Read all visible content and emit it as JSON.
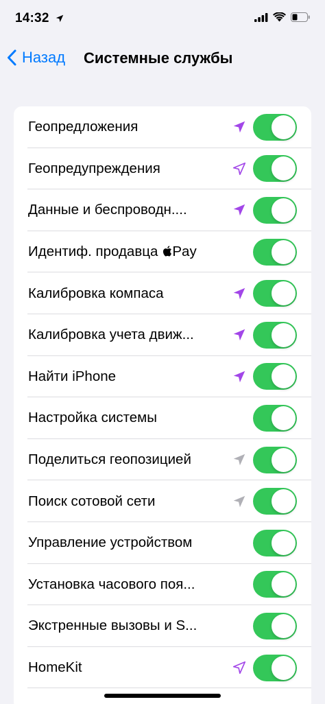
{
  "status_bar": {
    "time": "14:32",
    "icons": [
      "location-arrow-icon",
      "cellular-signal-icon",
      "wifi-icon",
      "battery-icon"
    ]
  },
  "nav": {
    "back_label": "Назад",
    "title": "Системные службы"
  },
  "colors": {
    "accent": "#007aff",
    "toggle_on": "#34c759",
    "location_active": "#a246e8",
    "location_recent": "#b0b0b6"
  },
  "services": [
    {
      "label": "Геопредложения",
      "location_indicator": "filled-purple",
      "enabled": true
    },
    {
      "label": "Геопредупреждения",
      "location_indicator": "outline-purple",
      "enabled": true
    },
    {
      "label": "Данные и беспроводн....",
      "location_indicator": "filled-purple",
      "enabled": true
    },
    {
      "label": "Идентиф. продавца",
      "suffix": "Pay",
      "has_apple_logo": true,
      "location_indicator": "none",
      "enabled": true
    },
    {
      "label": "Калибровка компаса",
      "location_indicator": "filled-purple",
      "enabled": true
    },
    {
      "label": "Калибровка учета движ...",
      "location_indicator": "filled-purple",
      "enabled": true
    },
    {
      "label": "Найти iPhone",
      "location_indicator": "filled-purple",
      "enabled": true
    },
    {
      "label": "Настройка системы",
      "location_indicator": "none",
      "enabled": true
    },
    {
      "label": "Поделиться геопозицией",
      "location_indicator": "filled-gray",
      "enabled": true
    },
    {
      "label": "Поиск сотовой сети",
      "location_indicator": "filled-gray",
      "enabled": true
    },
    {
      "label": "Управление устройством",
      "location_indicator": "none",
      "enabled": true
    },
    {
      "label": "Установка часового поя...",
      "location_indicator": "none",
      "enabled": true
    },
    {
      "label": "Экстренные вызовы и S...",
      "location_indicator": "none",
      "enabled": true
    },
    {
      "label": "HomeKit",
      "location_indicator": "outline-purple",
      "enabled": true
    }
  ]
}
